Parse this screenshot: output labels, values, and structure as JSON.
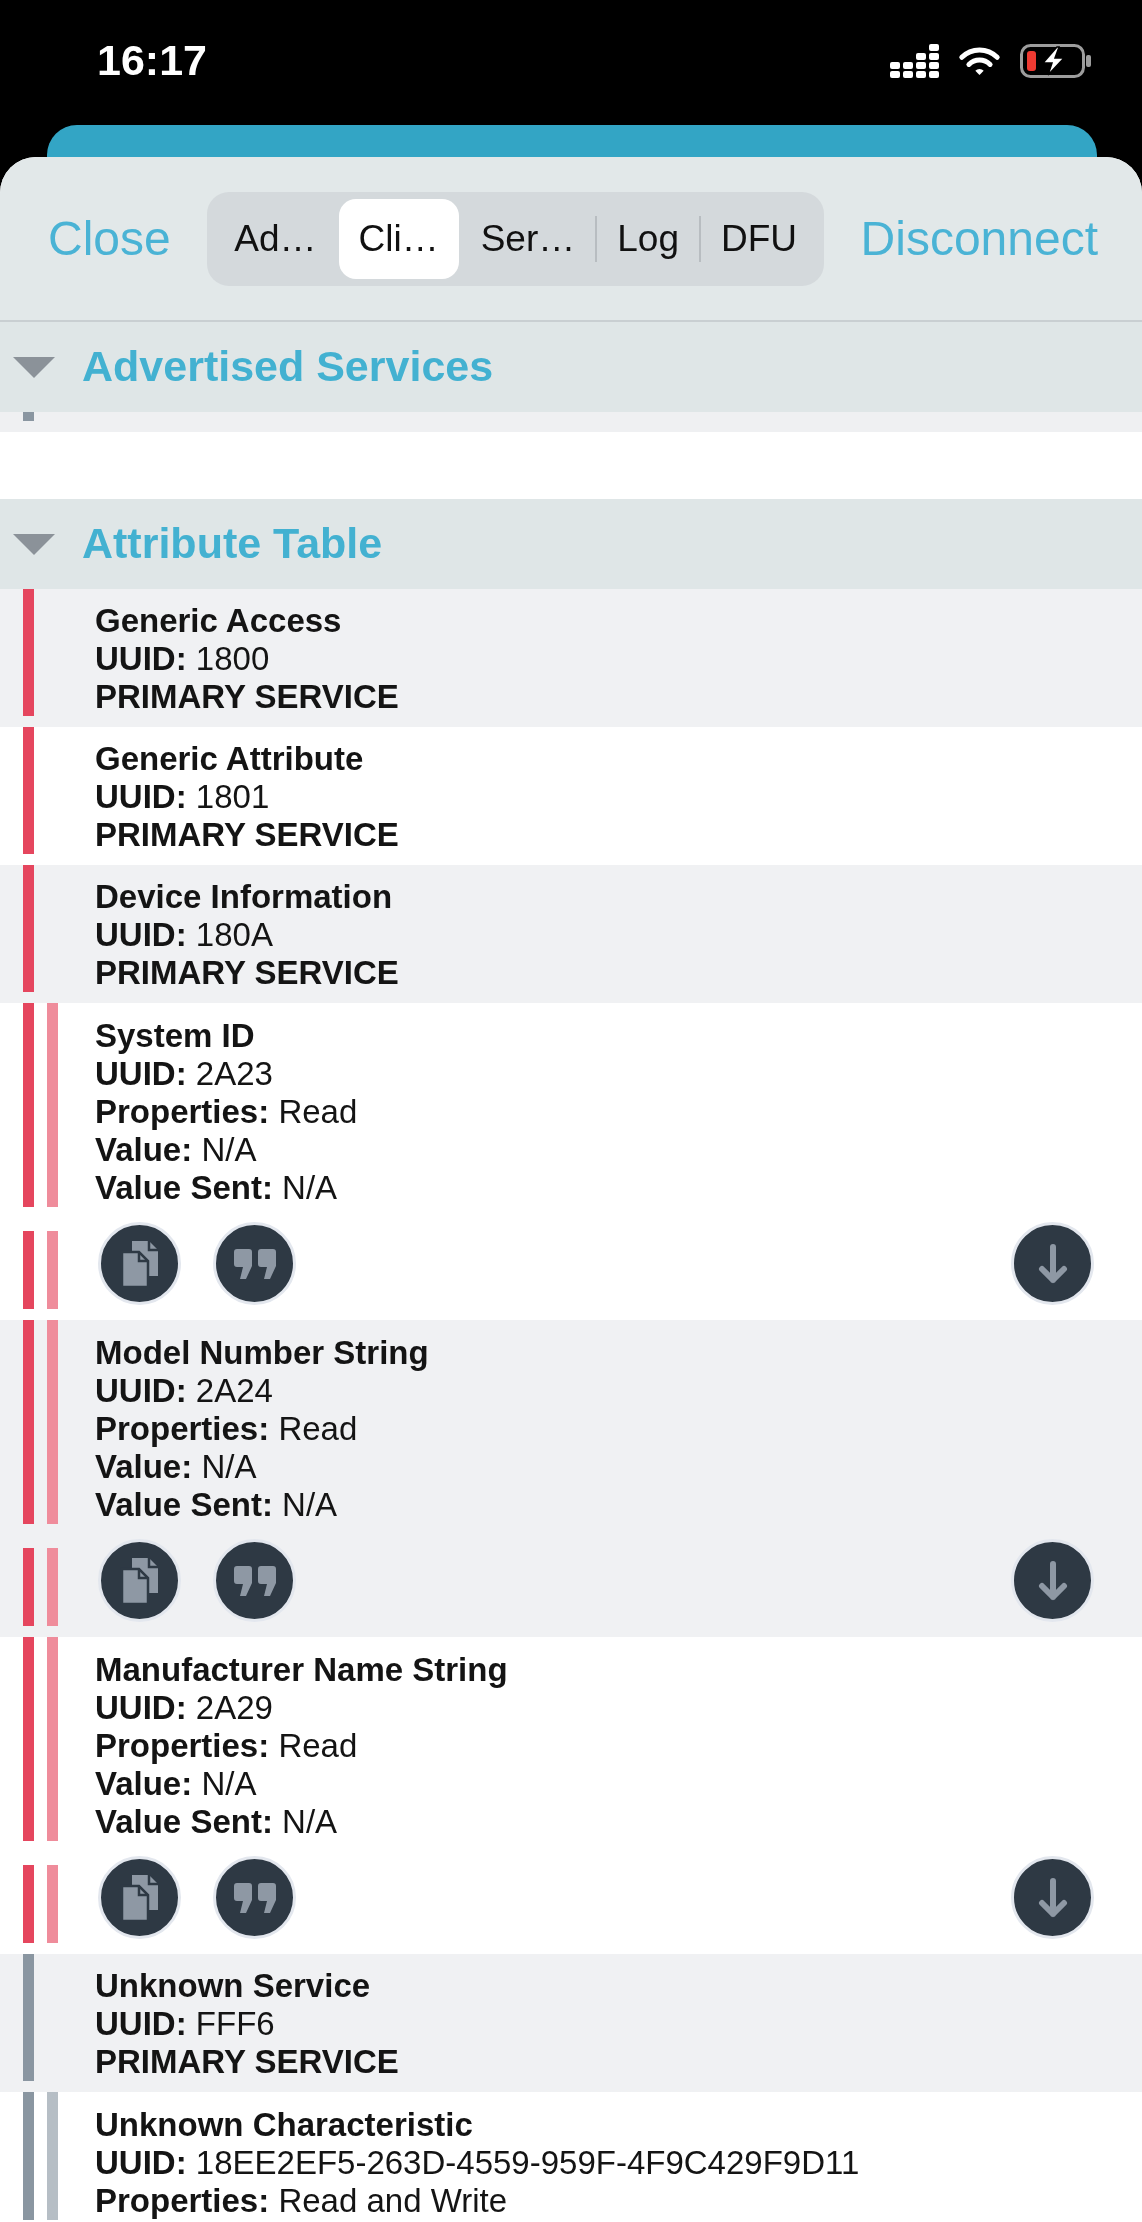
{
  "status_bar": {
    "time": "16:17"
  },
  "header": {
    "close": "Close",
    "tabs": [
      {
        "label": "Ad…",
        "selected": false
      },
      {
        "label": "Cli…",
        "selected": true
      },
      {
        "label": "Ser…",
        "selected": false
      },
      {
        "label": "Log",
        "selected": false
      },
      {
        "label": "DFU",
        "selected": false
      }
    ],
    "disconnect": "Disconnect"
  },
  "sections": [
    {
      "title": "Advertised Services",
      "expanded": true,
      "services": [
        {
          "color": "#8a96a1"
        }
      ]
    },
    {
      "title": "Attribute Table",
      "expanded": true,
      "services": [
        {
          "name": "Generic Access",
          "details": [
            "**UUID:** 1800"
          ],
          "type": "PRIMARY SERVICE",
          "color": "#e5465e"
        },
        {
          "name": "Generic Attribute",
          "details": [
            "**UUID:** 1801"
          ],
          "type": "PRIMARY SERVICE",
          "color": "#e5465e"
        },
        {
          "name": "Device Information",
          "details": [
            "**UUID:** 180A"
          ],
          "type": "PRIMARY SERVICE",
          "color": "#e5465e",
          "children": [
            {
              "name": "System ID",
              "details": [
                "**UUID:** 2A23",
                "**Properties:** Read",
                "**Value:** N/A",
                "**Value Sent:** N/A"
              ],
              "actions": [
                {
                  "kind": "copy"
                },
                {
                  "kind": "quote"
                },
                {
                  "kind": "read"
                }
              ]
            },
            {
              "name": "Model Number String",
              "details": [
                "**UUID:** 2A24",
                "**Properties:** Read",
                "**Value:** N/A",
                "**Value Sent:** N/A"
              ],
              "actions": [
                {
                  "kind": "copy"
                },
                {
                  "kind": "quote"
                },
                {
                  "kind": "read"
                }
              ]
            },
            {
              "name": "Manufacturer Name String",
              "details": [
                "**UUID:** 2A29",
                "**Properties:** Read",
                "**Value:** N/A",
                "**Value Sent:** N/A"
              ],
              "actions": [
                {
                  "kind": "copy"
                },
                {
                  "kind": "quote"
                },
                {
                  "kind": "read"
                }
              ]
            }
          ]
        },
        {
          "name": "Unknown Service",
          "details": [
            "**UUID:** FFF6"
          ],
          "type": "PRIMARY SERVICE",
          "color": "#8a96a1",
          "children": [
            {
              "name": "Unknown Characteristic",
              "details": [
                "**UUID:** 18EE2EF5-263D-4559-959F-4F9C429F9D11",
                "**Properties:** Read and Write"
              ]
            }
          ]
        }
      ]
    }
  ]
}
